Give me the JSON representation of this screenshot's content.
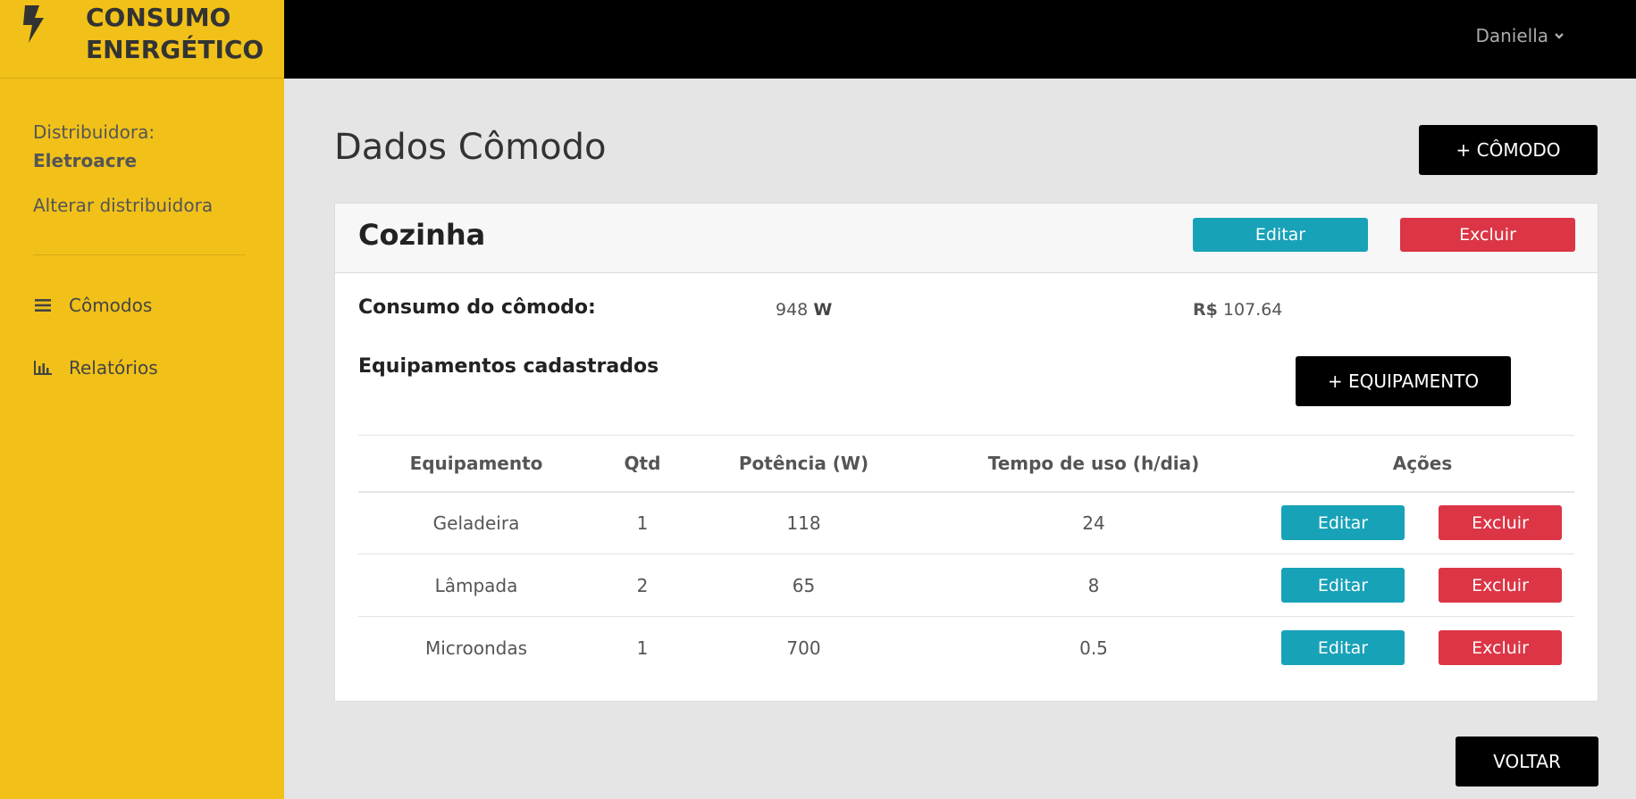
{
  "app": {
    "brand_line1": "CONSUMO",
    "brand_line2": "ENERGÉTICO",
    "brand_icon": "lightning-bolt-icon"
  },
  "sidebar": {
    "distributor_label": "Distribuidora:",
    "distributor_name": "Eletroacre",
    "change_distributor": "Alterar distribuidora",
    "items": [
      {
        "label": "Cômodos",
        "icon": "list-icon"
      },
      {
        "label": "Relatórios",
        "icon": "bar-chart-icon"
      }
    ]
  },
  "topbar": {
    "user_name": "Daniella"
  },
  "main": {
    "title": "Dados Cômodo",
    "add_room_button": "+ CÔMODO",
    "room": {
      "name": "Cozinha",
      "edit_label": "Editar",
      "delete_label": "Excluir",
      "consumption_label": "Consumo do cômodo:",
      "consumption_value": "948",
      "consumption_unit": "W",
      "cost_currency": "R$",
      "cost_value": "107.64",
      "equipment_label": "Equipamentos cadastrados",
      "add_equipment_button": "+ EQUIPAMENTO",
      "table": {
        "headers": [
          "Equipamento",
          "Qtd",
          "Potência (W)",
          "Tempo de uso (h/dia)",
          "Ações"
        ],
        "rows": [
          {
            "equipment": "Geladeira",
            "qty": "1",
            "power": "118",
            "usage": "24",
            "edit": "Editar",
            "delete": "Excluir"
          },
          {
            "equipment": "Lâmpada",
            "qty": "2",
            "power": "65",
            "usage": "8",
            "edit": "Editar",
            "delete": "Excluir"
          },
          {
            "equipment": "Microondas",
            "qty": "1",
            "power": "700",
            "usage": "0.5",
            "edit": "Editar",
            "delete": "Excluir"
          }
        ]
      }
    },
    "back_button": "VOLTAR"
  },
  "colors": {
    "sidebar_bg": "#f1c119",
    "topbar_bg": "#000000",
    "page_bg": "#e5e5e5",
    "edit_button": "#17a2b8",
    "delete_button": "#dc3545",
    "primary_button": "#000000"
  }
}
